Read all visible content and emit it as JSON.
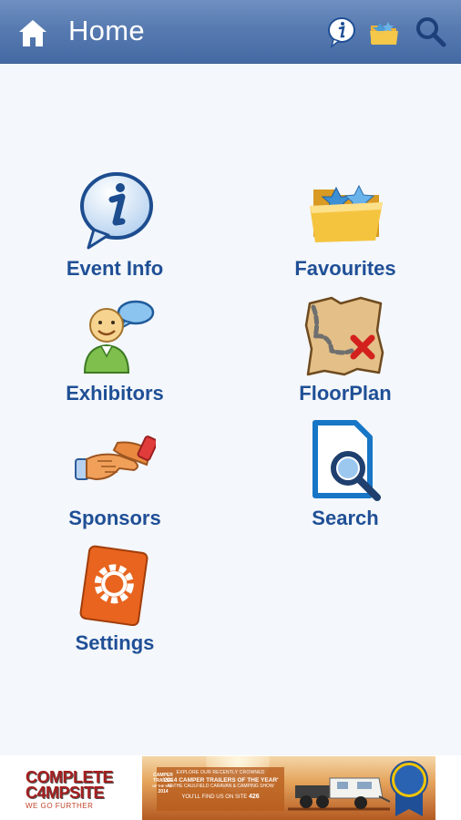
{
  "header": {
    "title": "Home",
    "icons": [
      "home-icon",
      "info-icon",
      "favourites-folder-icon",
      "search-icon"
    ]
  },
  "menu": {
    "items": [
      {
        "label": "Event Info",
        "icon": "info-bubble-icon"
      },
      {
        "label": "Favourites",
        "icon": "star-folder-icon"
      },
      {
        "label": "Exhibitors",
        "icon": "person-chat-icon"
      },
      {
        "label": "FloorPlan",
        "icon": "treasure-map-icon"
      },
      {
        "label": "Sponsors",
        "icon": "handshake-icon"
      },
      {
        "label": "Search",
        "icon": "document-search-icon"
      },
      {
        "label": "Settings",
        "icon": "gear-icon"
      }
    ]
  },
  "ad": {
    "brand_line1": "COMPLETE",
    "brand_line2": "C4MPSITE",
    "brand_tagline": "WE GO FURTHER",
    "line1": "EXPLORE OUR RECENTLY CROWNED",
    "line2": "'2014 CAMPER TRAILERS OF THE YEAR'",
    "line3": "AT THE CAULFIELD CARAVAN & CAMPING SHOW",
    "line4_prefix": "YOU'LL FIND US ON SITE",
    "site_number": "426",
    "badge_line1": "CAMPER",
    "badge_line2": "TRAILER",
    "badge_line3": "OF THE YEAR",
    "badge_year": "2014"
  },
  "colors": {
    "header": "#577bb1",
    "label": "#1f4f96",
    "background": "#f4f7fb",
    "brand_red": "#a51f1f"
  }
}
